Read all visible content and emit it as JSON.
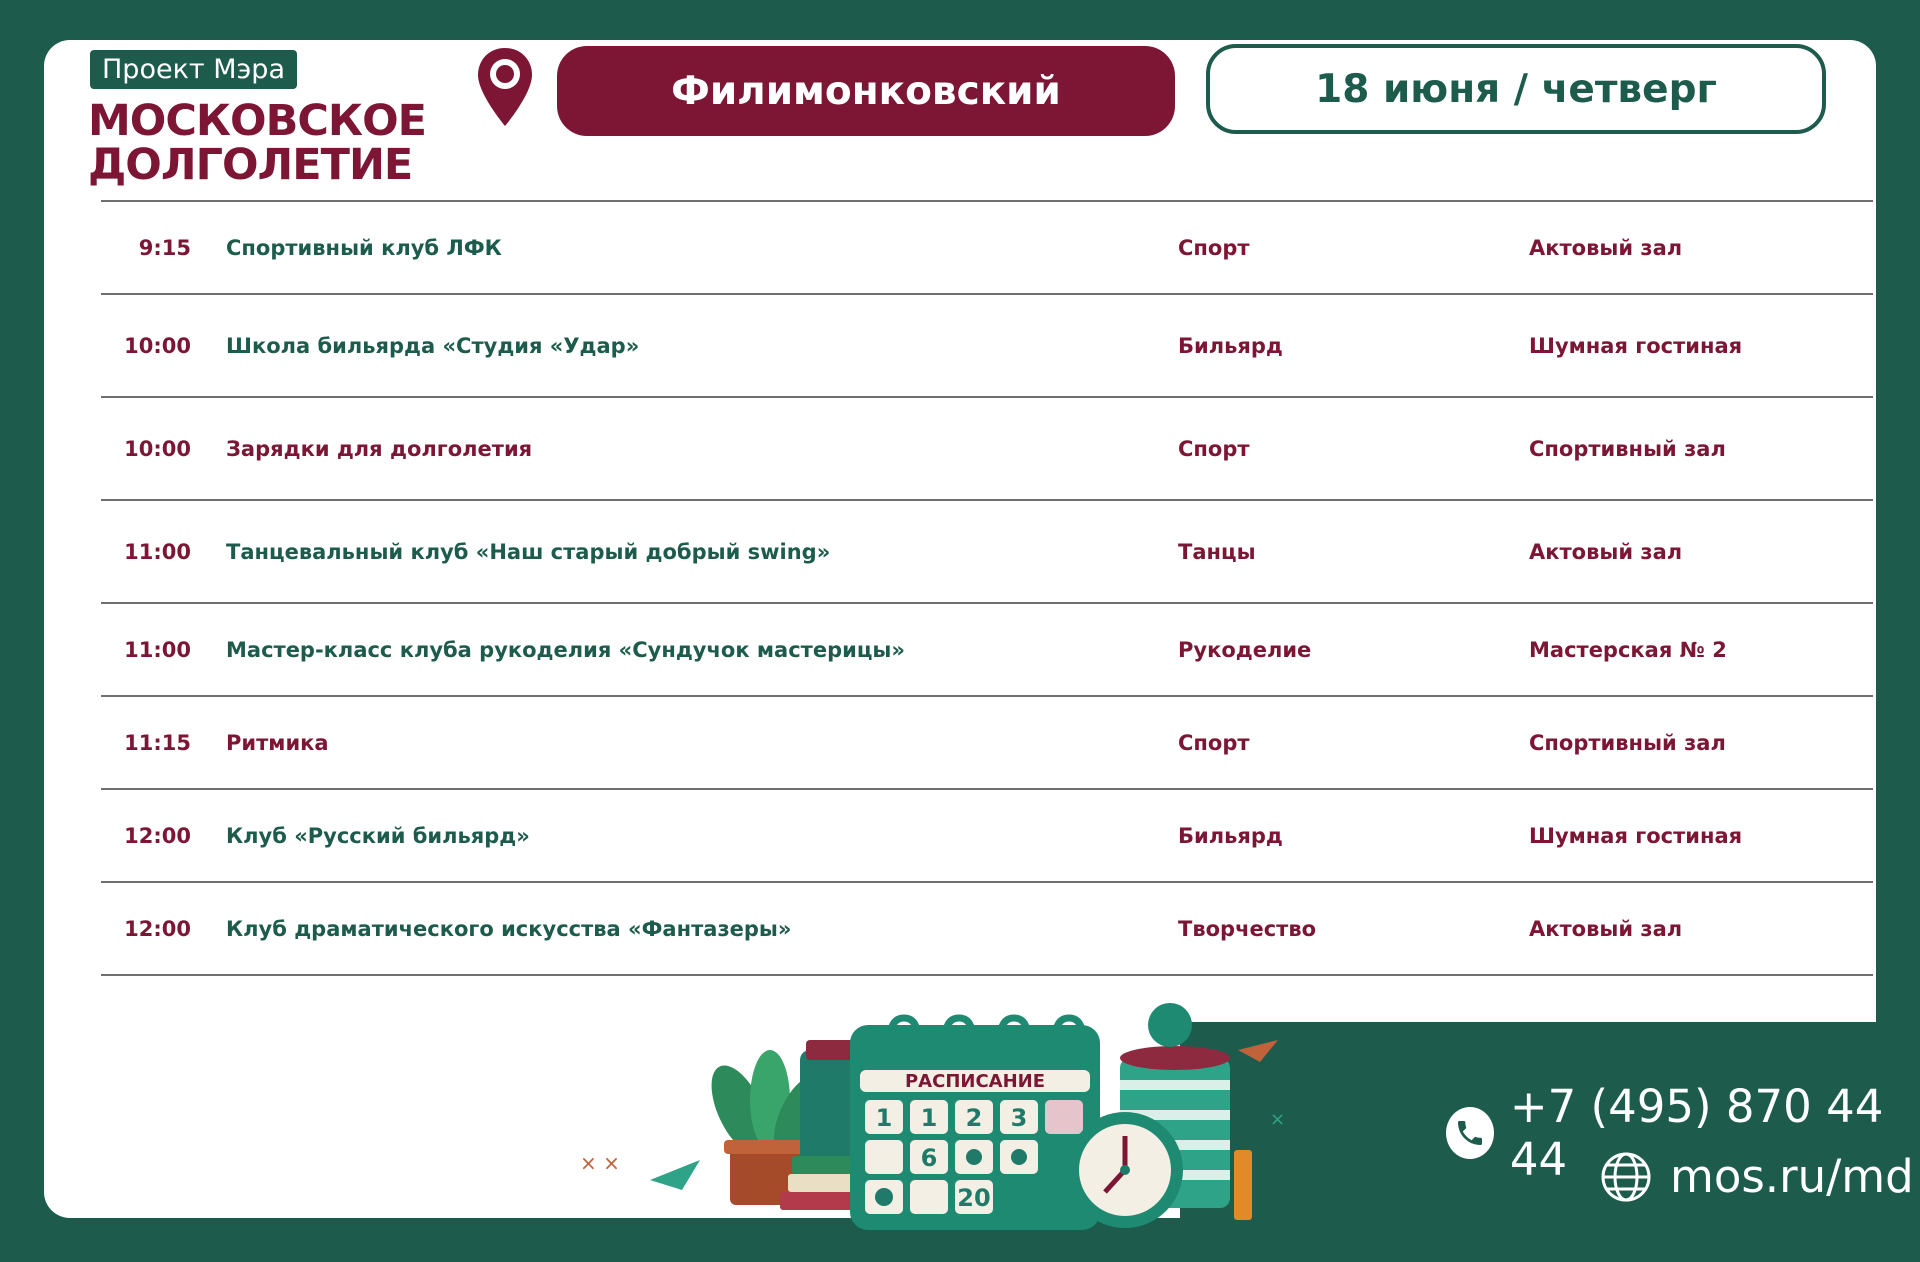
{
  "header": {
    "badge": "Проект Мэра",
    "logo_line1": "МОСКОВСКОЕ",
    "logo_line2": "ДОЛГОЛЕТИЕ",
    "district": "Филимонковский",
    "date": "18 июня / четверг"
  },
  "schedule": [
    {
      "time": "9:15",
      "event": "Спортивный клуб ЛФК",
      "category": "Спорт",
      "place": "Актовый зал"
    },
    {
      "time": "10:00",
      "event": "Школа бильярда «Студия «Удар»",
      "category": "Бильярд",
      "place": "Шумная гостиная"
    },
    {
      "time": "10:00",
      "event": "Зарядки для долголетия",
      "category": "Спорт",
      "place": "Спортивный зал"
    },
    {
      "time": "11:00",
      "event": "Танцевальный клуб «Наш старый добрый swing»",
      "category": "Танцы",
      "place": "Актовый зал"
    },
    {
      "time": "11:00",
      "event": "Мастер-класс клуба рукоделия  «Сундучок мастерицы»",
      "category": "Рукоделие",
      "place": "Мастерская № 2"
    },
    {
      "time": "11:15",
      "event": "Ритмика",
      "category": "Спорт",
      "place": "Спортивный зал"
    },
    {
      "time": "12:00",
      "event": "Клуб «Русский бильярд»",
      "category": "Бильярд",
      "place": "Шумная гостиная"
    },
    {
      "time": "12:00",
      "event": "Клуб драматического искусства «Фантазеры»",
      "category": "Творчество",
      "place": "Актовый зал"
    }
  ],
  "illustration": {
    "label": "РАСПИСАНИЕ",
    "numbers": [
      "1",
      "1",
      "2",
      "3",
      "6",
      "20"
    ]
  },
  "contacts": {
    "phone": "+7 (495) 870 44 44",
    "website": "mos.ru/md"
  },
  "colors": {
    "brand_green": "#1d5c4c",
    "brand_burgundy": "#7c1634"
  }
}
